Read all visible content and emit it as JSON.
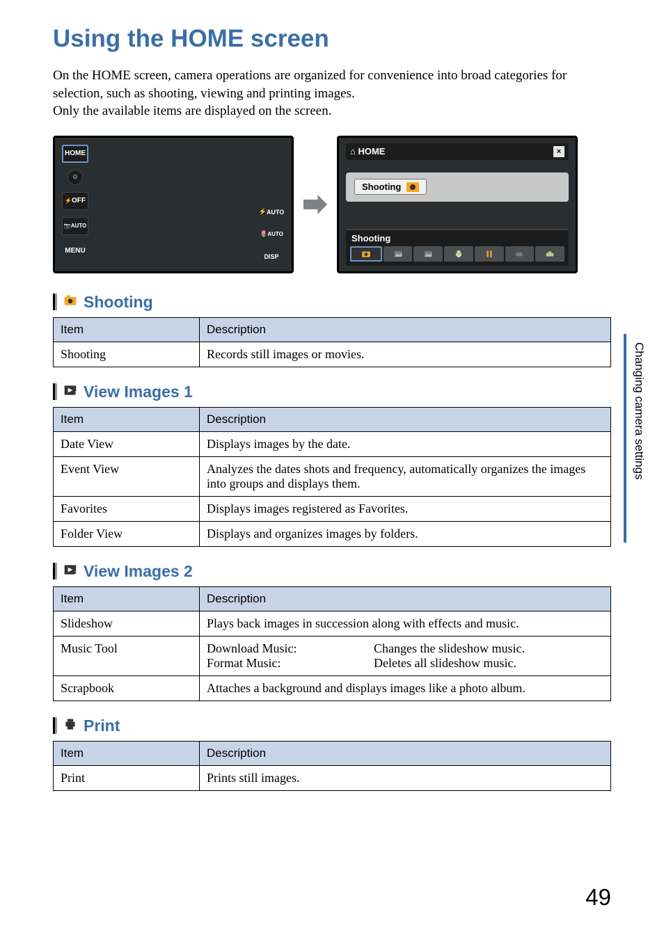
{
  "title": "Using the HOME screen",
  "intro": "On the HOME screen, camera operations are organized for convenience into broad categories for selection, such as shooting, viewing and printing images.\nOnly the available items are displayed on the screen.",
  "side_label": "Changing camera settings",
  "page_number": "49",
  "lcd_left": {
    "home": "HOME",
    "off": "OFF",
    "auto": "AUTO",
    "menu": "MENU",
    "zauto": "AUTO",
    "flashauto": "AUTO",
    "disp": "DISP"
  },
  "lcd_right": {
    "top_label": "HOME",
    "close": "×",
    "main_btn": "Shooting",
    "bottom_label": "Shooting"
  },
  "table_headers": {
    "item": "Item",
    "description": "Description"
  },
  "sections": {
    "shooting": {
      "title": "Shooting",
      "rows": [
        {
          "item": "Shooting",
          "desc": "Records still images or movies."
        }
      ]
    },
    "view1": {
      "title": "View Images 1",
      "rows": [
        {
          "item": "Date View",
          "desc": "Displays images by the date."
        },
        {
          "item": "Event View",
          "desc": "Analyzes the dates shots and frequency, automatically organizes the images into groups and displays them."
        },
        {
          "item": "Favorites",
          "desc": "Displays images registered as Favorites."
        },
        {
          "item": "Folder View",
          "desc": "Displays and organizes images by folders."
        }
      ]
    },
    "view2": {
      "title": "View Images 2",
      "rows": [
        {
          "item": "Slideshow",
          "desc": "Plays back images in succession along with effects and music."
        },
        {
          "item": "Music Tool",
          "c1a": "Download Music:",
          "c1b": "Format Music:",
          "c2a": "Changes the slideshow music.",
          "c2b": "Deletes all slideshow music."
        },
        {
          "item": "Scrapbook",
          "desc": "Attaches a background and displays images like a photo album."
        }
      ]
    },
    "print": {
      "title": "Print",
      "rows": [
        {
          "item": "Print",
          "desc": "Prints still images."
        }
      ]
    }
  }
}
